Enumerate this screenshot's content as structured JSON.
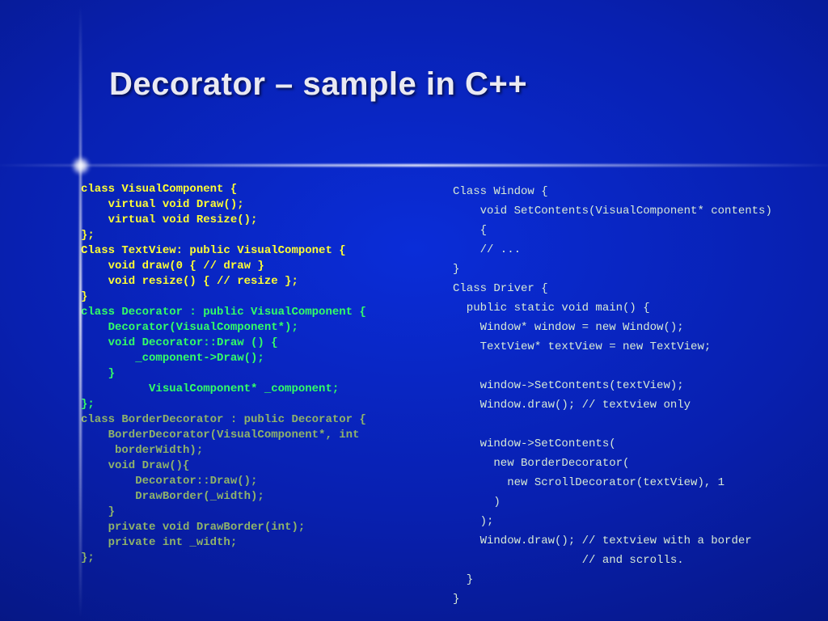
{
  "title": "Decorator – sample in C++",
  "left": {
    "block1": "class VisualComponent {\n    virtual void Draw();\n    virtual void Resize();\n};\nClass TextView: public VisualComponet {\n    void draw(0 { // draw }\n    void resize() { // resize };\n}",
    "block2": "class Decorator : public VisualComponent {\n    Decorator(VisualComponent*);\n    void Decorator::Draw () {\n        _component->Draw();\n    }\n          VisualComponent* _component;\n};",
    "block3": "class BorderDecorator : public Decorator {\n    BorderDecorator(VisualComponent*, int\n     borderWidth);\n    void Draw(){\n        Decorator::Draw();\n        DrawBorder(_width);\n    }\n    private void DrawBorder(int);\n    private int _width;\n};"
  },
  "right": {
    "block": "Class Window {\n    void SetContents(VisualComponent* contents)\n    {\n    // ...\n}\nClass Driver {\n  public static void main() {\n    Window* window = new Window();\n    TextView* textView = new TextView;\n\n    window->SetContents(textView);\n    Window.draw(); // textview only\n\n    window->SetContents(\n      new BorderDecorator(\n        new ScrollDecorator(textView), 1\n      )\n    );\n    Window.draw(); // textview with a border\n                   // and scrolls.\n  }\n}"
  }
}
